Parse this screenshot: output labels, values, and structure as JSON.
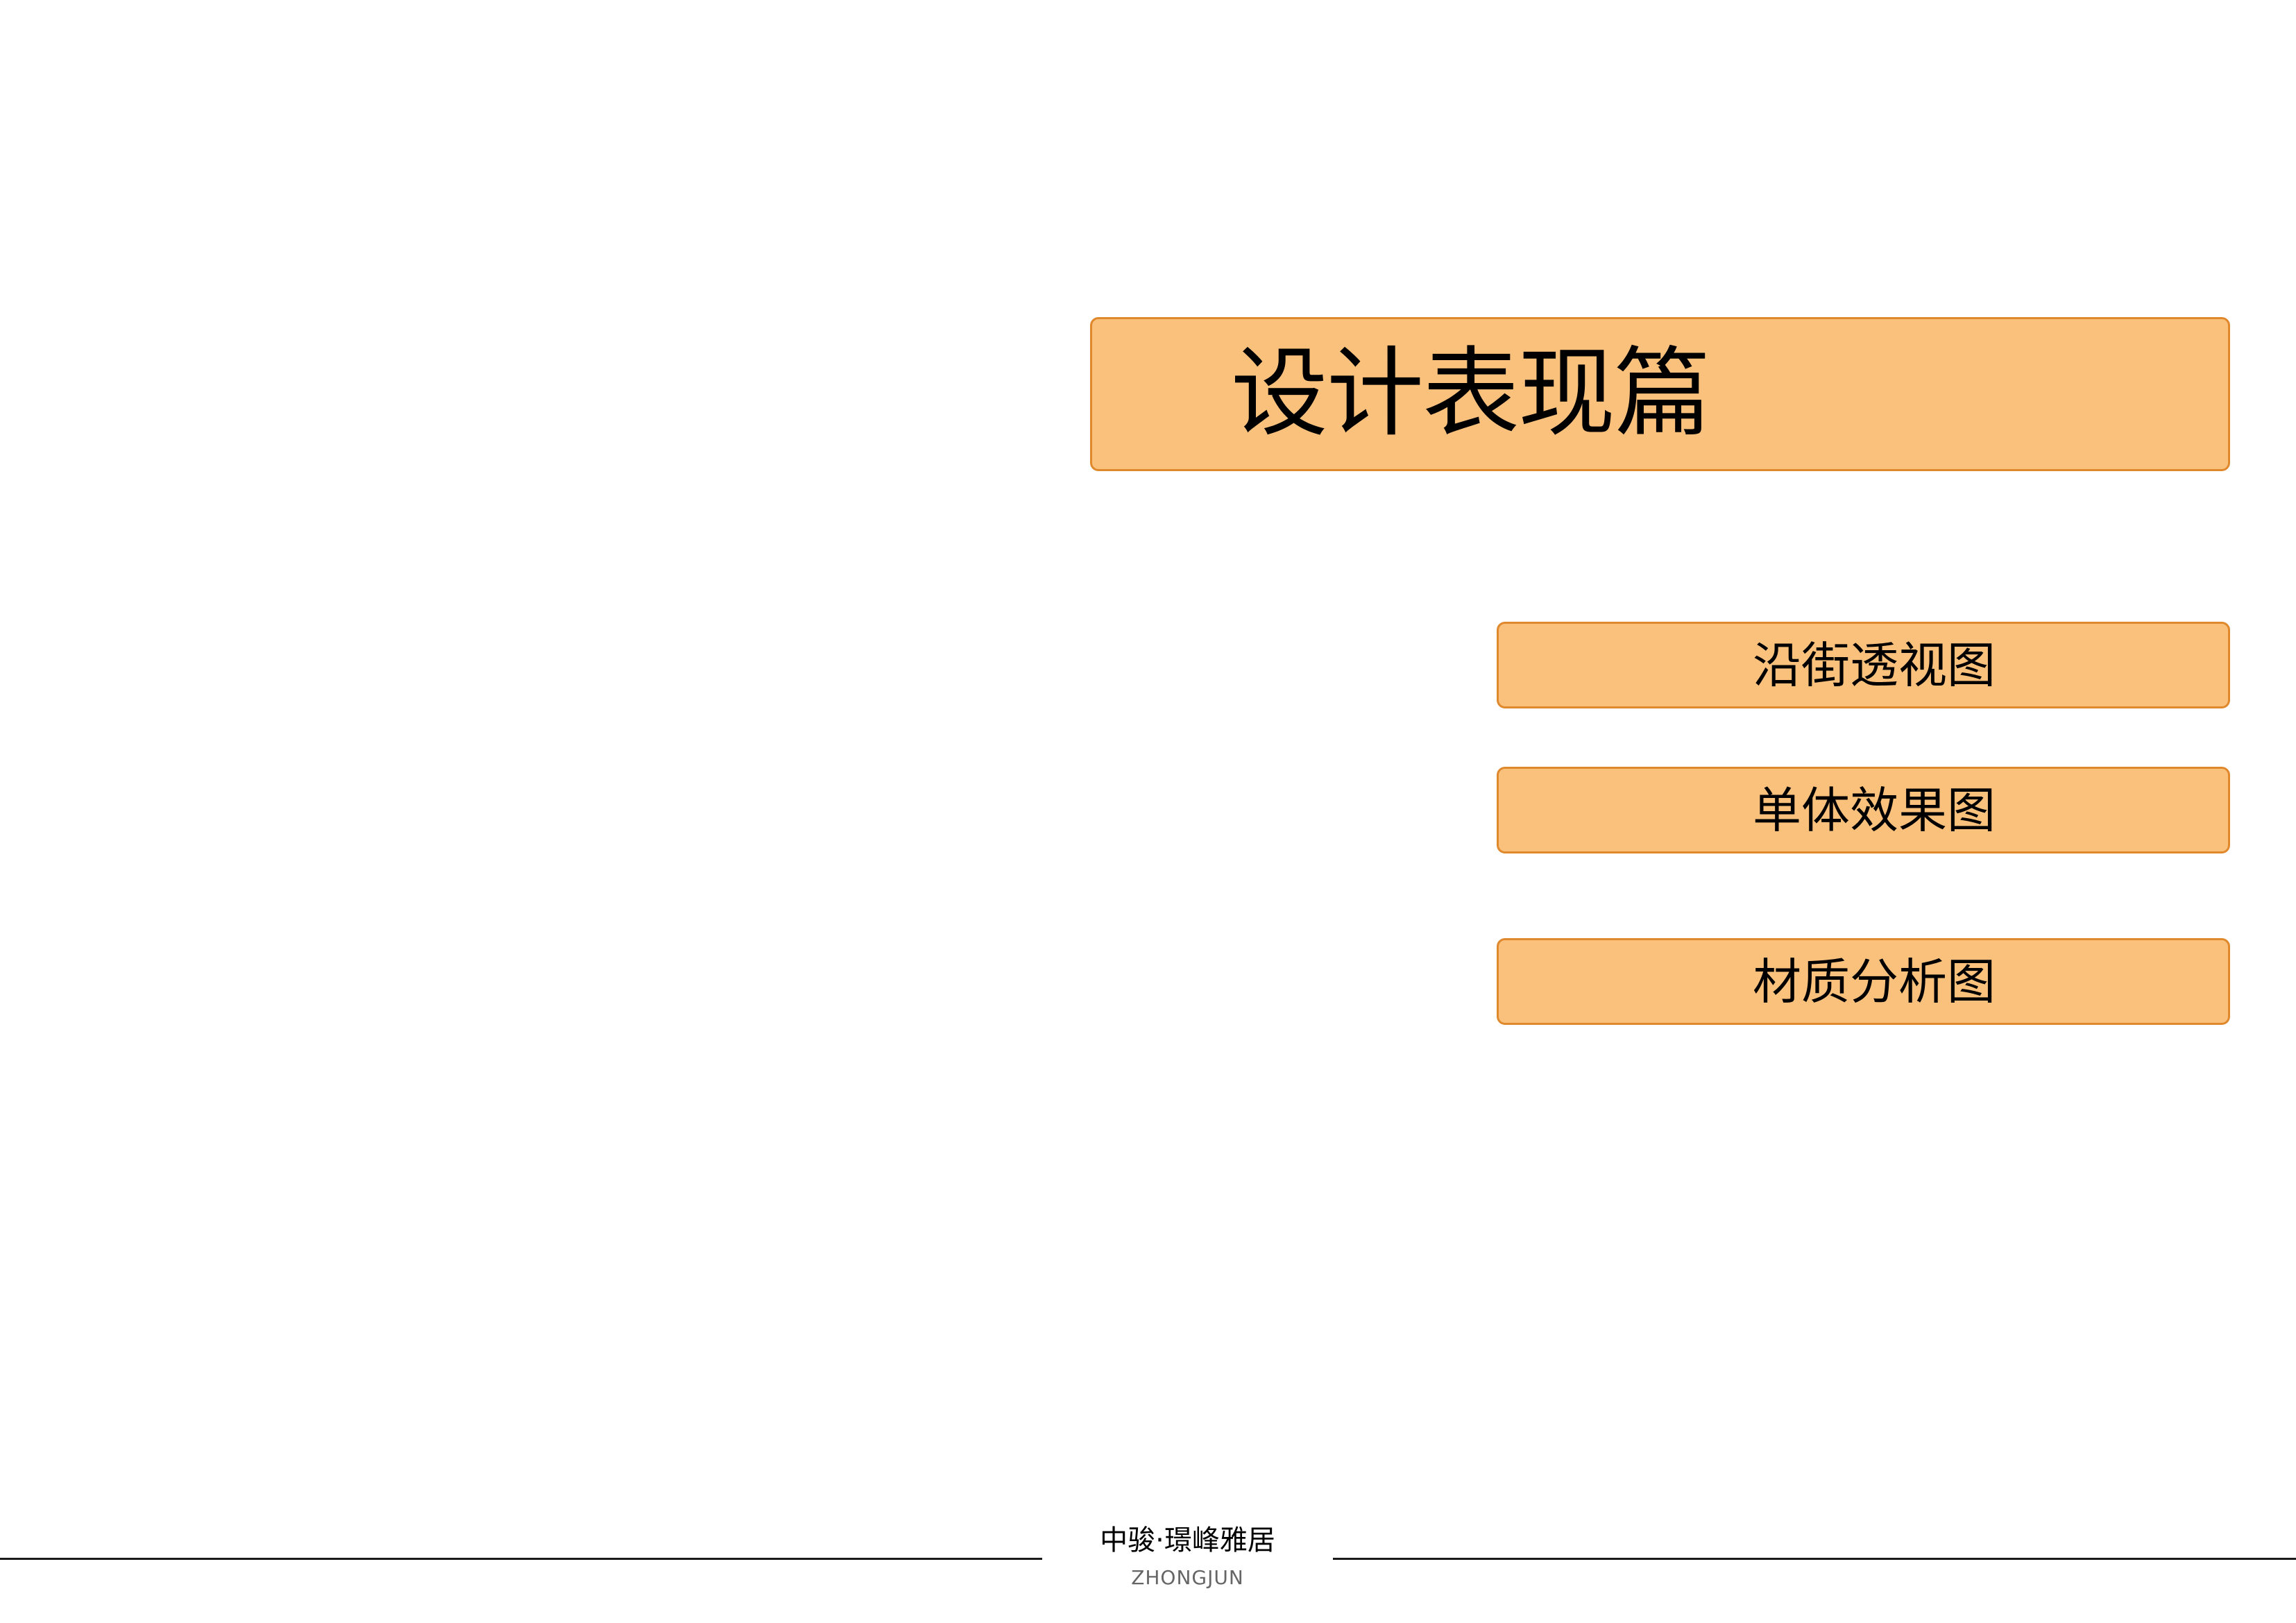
{
  "title": "设计表现篇",
  "menu": {
    "items": [
      {
        "label": "沿街透视图"
      },
      {
        "label": "单体效果图"
      },
      {
        "label": "材质分析图"
      }
    ]
  },
  "footer": {
    "brand": "中骏·璟峰雅居",
    "sub": "ZHONGJUN"
  },
  "colors": {
    "box_fill": "#fac17d",
    "box_border": "#e0882c",
    "text": "#000000"
  }
}
